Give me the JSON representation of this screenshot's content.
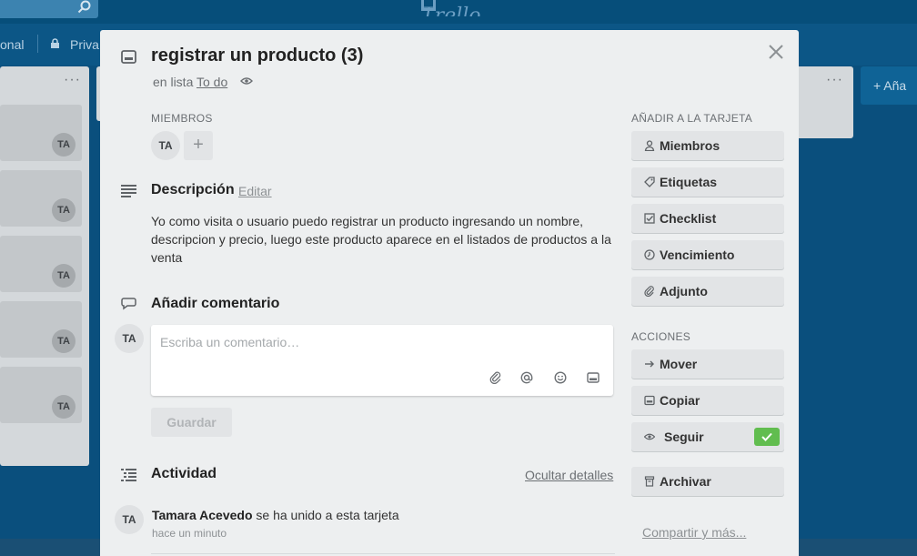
{
  "background": {
    "logo_text": "Trello",
    "bar_left_text": "onal",
    "bar_privacy_text": "Priva",
    "add_list_label": "+ Aña",
    "card_avatar": "TA"
  },
  "card": {
    "title": "registrar un producto (3)",
    "in_list_prefix": "en lista",
    "list_name": "To do"
  },
  "members": {
    "label": "MIEMBROS",
    "avatar": "TA",
    "add_label": "+"
  },
  "description": {
    "heading": "Descripción",
    "edit_label": "Editar",
    "text": "Yo como visita o usuario puedo registrar un producto ingresando un nombre, descripcion y precio, luego este producto aparece en el listados de productos a la venta"
  },
  "comment": {
    "heading": "Añadir comentario",
    "avatar": "TA",
    "placeholder": "Escriba un comentario…",
    "save_label": "Guardar"
  },
  "activity": {
    "heading": "Actividad",
    "hide_details_label": "Ocultar detalles",
    "avatar": "TA",
    "user": "Tamara Acevedo",
    "action": "se ha unido a esta tarjeta",
    "time": "hace un minuto"
  },
  "sidebar": {
    "add_label": "AÑADIR A LA TARJETA",
    "add_items": [
      {
        "label": "Miembros",
        "icon": "person-icon"
      },
      {
        "label": "Etiquetas",
        "icon": "tag-icon"
      },
      {
        "label": "Checklist",
        "icon": "checkbox-icon"
      },
      {
        "label": "Vencimiento",
        "icon": "clock-icon"
      },
      {
        "label": "Adjunto",
        "icon": "paperclip-icon"
      }
    ],
    "actions_label": "ACCIONES",
    "action_items": [
      {
        "label": "Mover",
        "icon": "arrow-right-icon"
      },
      {
        "label": "Copiar",
        "icon": "card-icon"
      },
      {
        "label": "Seguir",
        "icon": "eye-icon",
        "checked": true
      },
      {
        "label": "Archivar",
        "icon": "archive-icon"
      }
    ],
    "share_label": "Compartir y más..."
  },
  "colors": {
    "board_bg": "#0a4f7d",
    "modal_bg": "#edeff0",
    "button_bg": "#e2e4e6",
    "check_green": "#61bd4f"
  }
}
